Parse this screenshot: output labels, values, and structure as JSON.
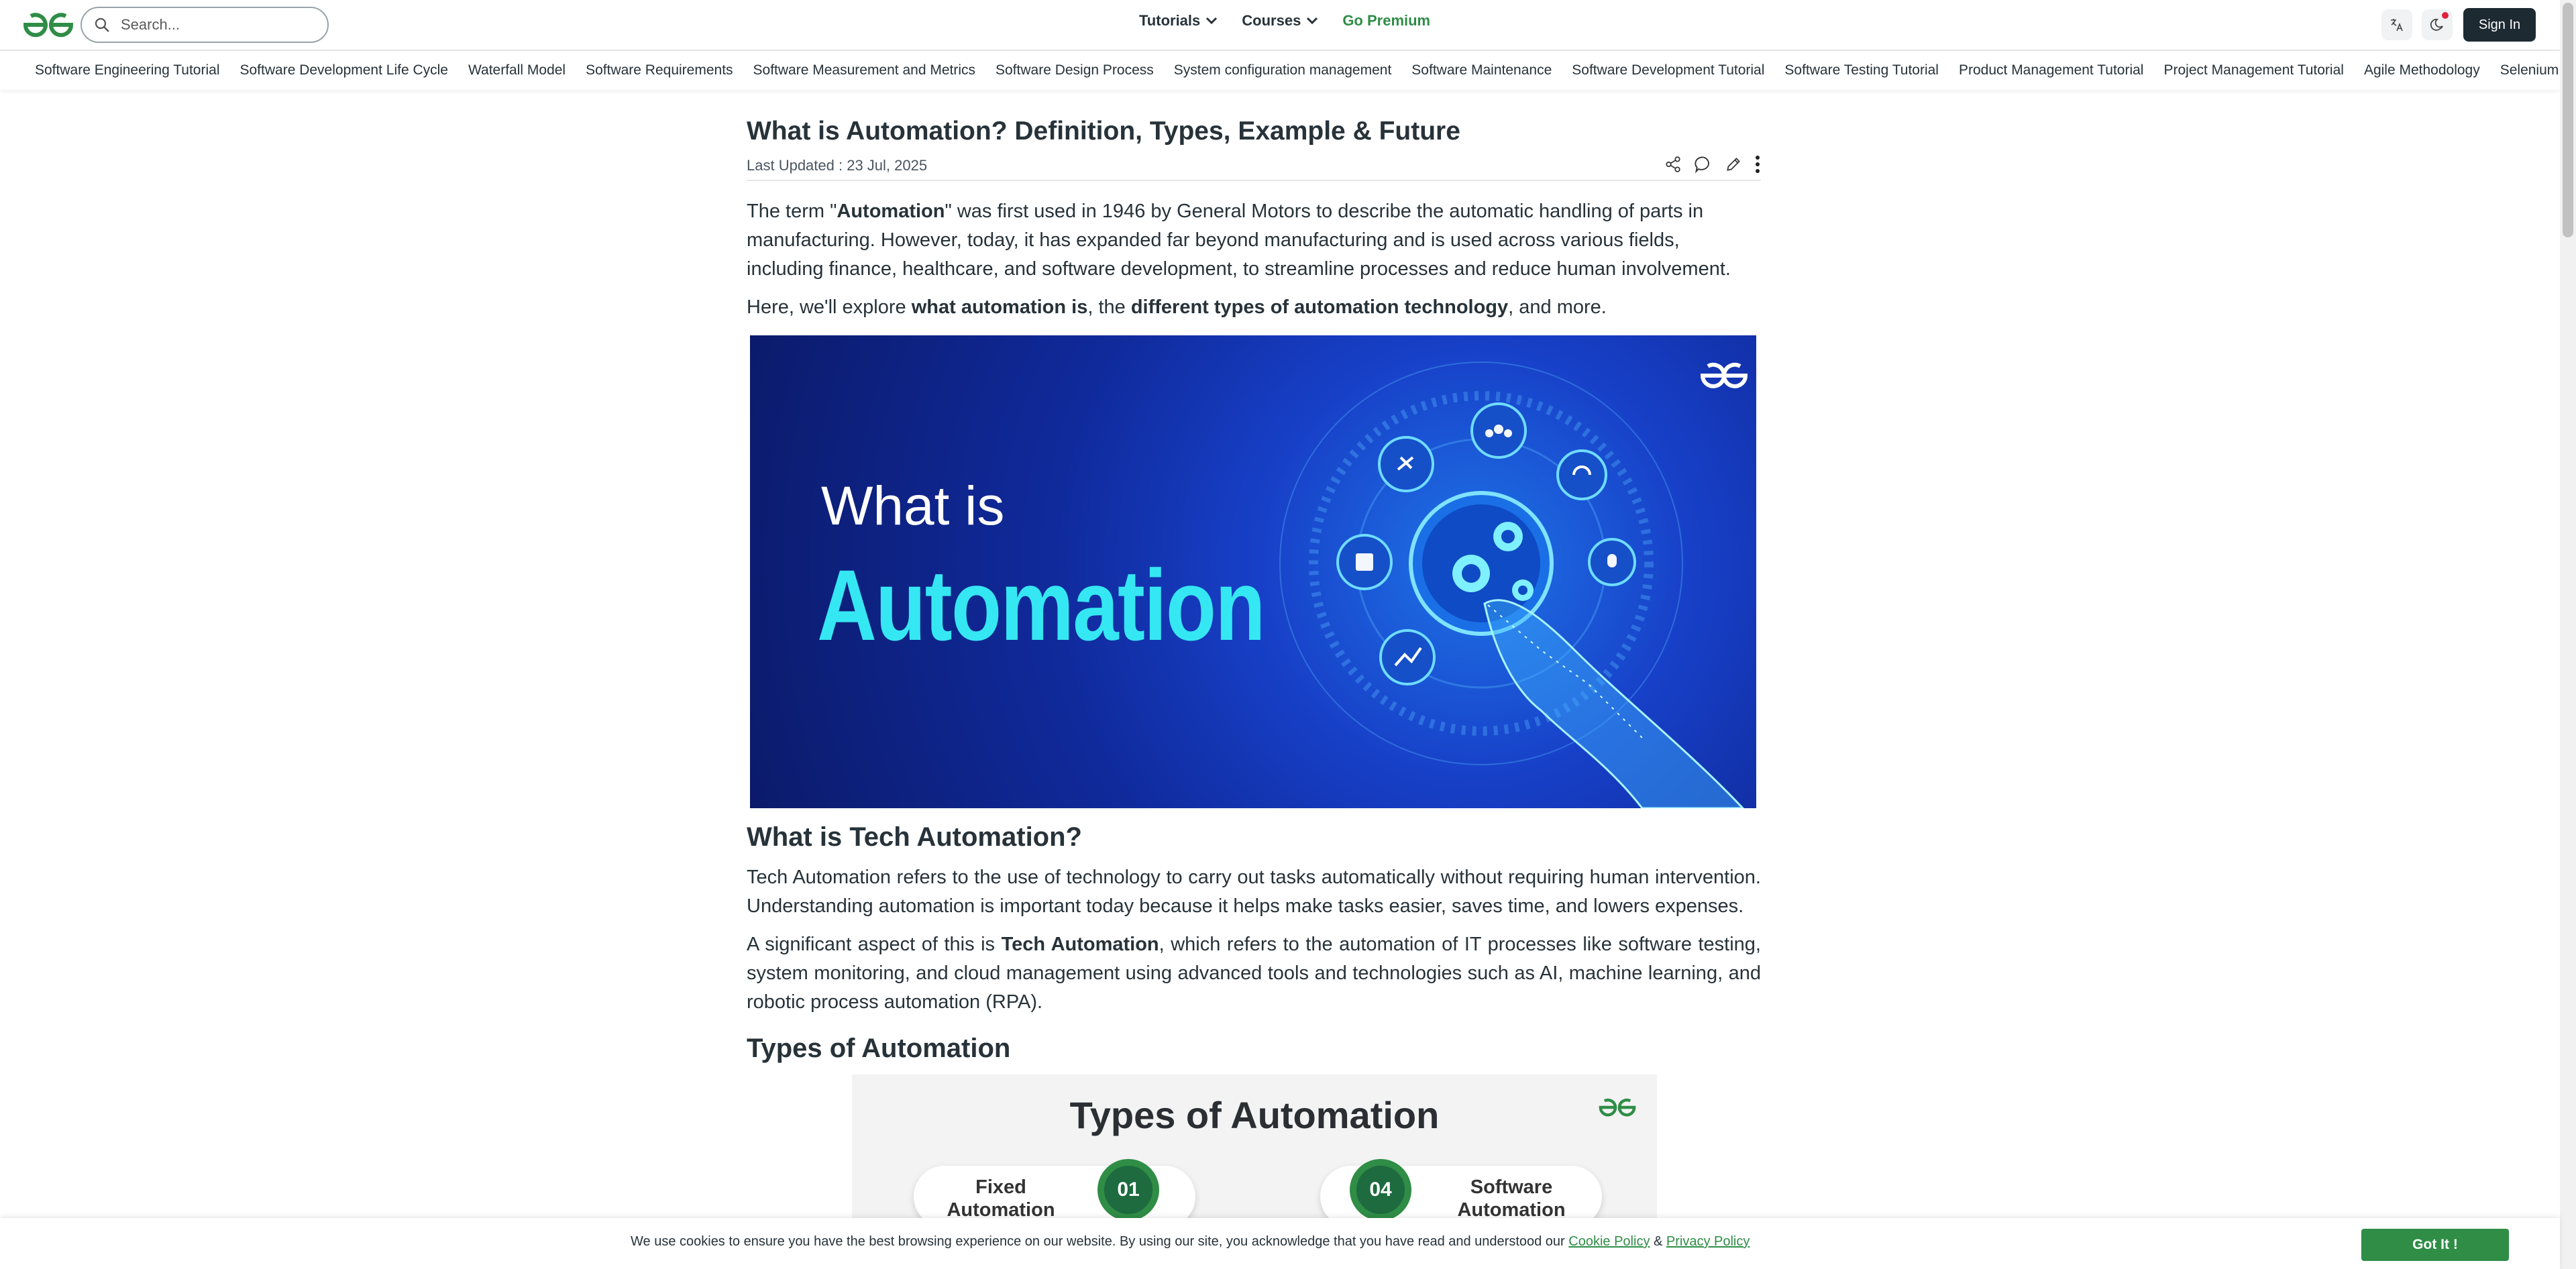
{
  "header": {
    "search_placeholder": "Search...",
    "nav": [
      {
        "label": "Tutorials"
      },
      {
        "label": "Courses"
      }
    ],
    "premium_label": "Go Premium",
    "signin_label": "Sign In"
  },
  "subnav": {
    "items": [
      "Software Engineering Tutorial",
      "Software Development Life Cycle",
      "Waterfall Model",
      "Software Requirements",
      "Software Measurement and Metrics",
      "Software Design Process",
      "System configuration management",
      "Software Maintenance",
      "Software Development Tutorial",
      "Software Testing Tutorial",
      "Product Management Tutorial",
      "Project Management Tutorial",
      "Agile Methodology",
      "Selenium"
    ]
  },
  "article": {
    "title": "What is Automation? Definition, Types, Example & Future",
    "updated": "Last Updated : 23 Jul, 2025",
    "p1_a": "The term \"",
    "p1_b": "Automation",
    "p1_c": "\" was first used in 1946 by General Motors to describe the automatic handling of parts in manufacturing. However, today, it has expanded far beyond manufacturing and is used across various fields, including finance, healthcare, and software development, to streamline processes and reduce human involvement.",
    "p2_a": "Here, we'll explore ",
    "p2_b": "what automation is",
    "p2_c": ", the ",
    "p2_d": "different types of automation technology",
    "p2_e": ", and more.",
    "hero_line1": "What is",
    "hero_line2": "Automation",
    "h2_tech": "What is Tech Automation?",
    "p3": "Tech Automation refers to the use of technology to carry out tasks automatically without requiring human intervention. Understanding automation is important today because it helps make tasks easier, saves time, and lowers expenses.",
    "p4_a": "A significant aspect of this is ",
    "p4_b": "Tech Automation",
    "p4_c": ", which refers to the automation of IT processes like software testing, system monitoring, and cloud management using advanced tools and technologies such as AI, machine learning, and robotic process automation (RPA).",
    "h2_types": "Types of Automation",
    "types_img_title": "Types of Automation",
    "pill1_line1": "Fixed",
    "pill1_line2": "Automation",
    "pill1_num": "01",
    "pill2_line1": "Software",
    "pill2_line2": "Automation",
    "pill2_num": "04"
  },
  "cookie": {
    "text": "We use cookies to ensure you have the best browsing experience on our website. By using our site, you acknowledge that you have read and understood our ",
    "cookie_link": "Cookie Policy",
    "amp": " & ",
    "privacy_link": "Privacy Policy",
    "button": "Got It !"
  },
  "colors": {
    "brand_green": "#2f8d46",
    "text": "#273239",
    "hero_cyan": "#35e7f2"
  }
}
